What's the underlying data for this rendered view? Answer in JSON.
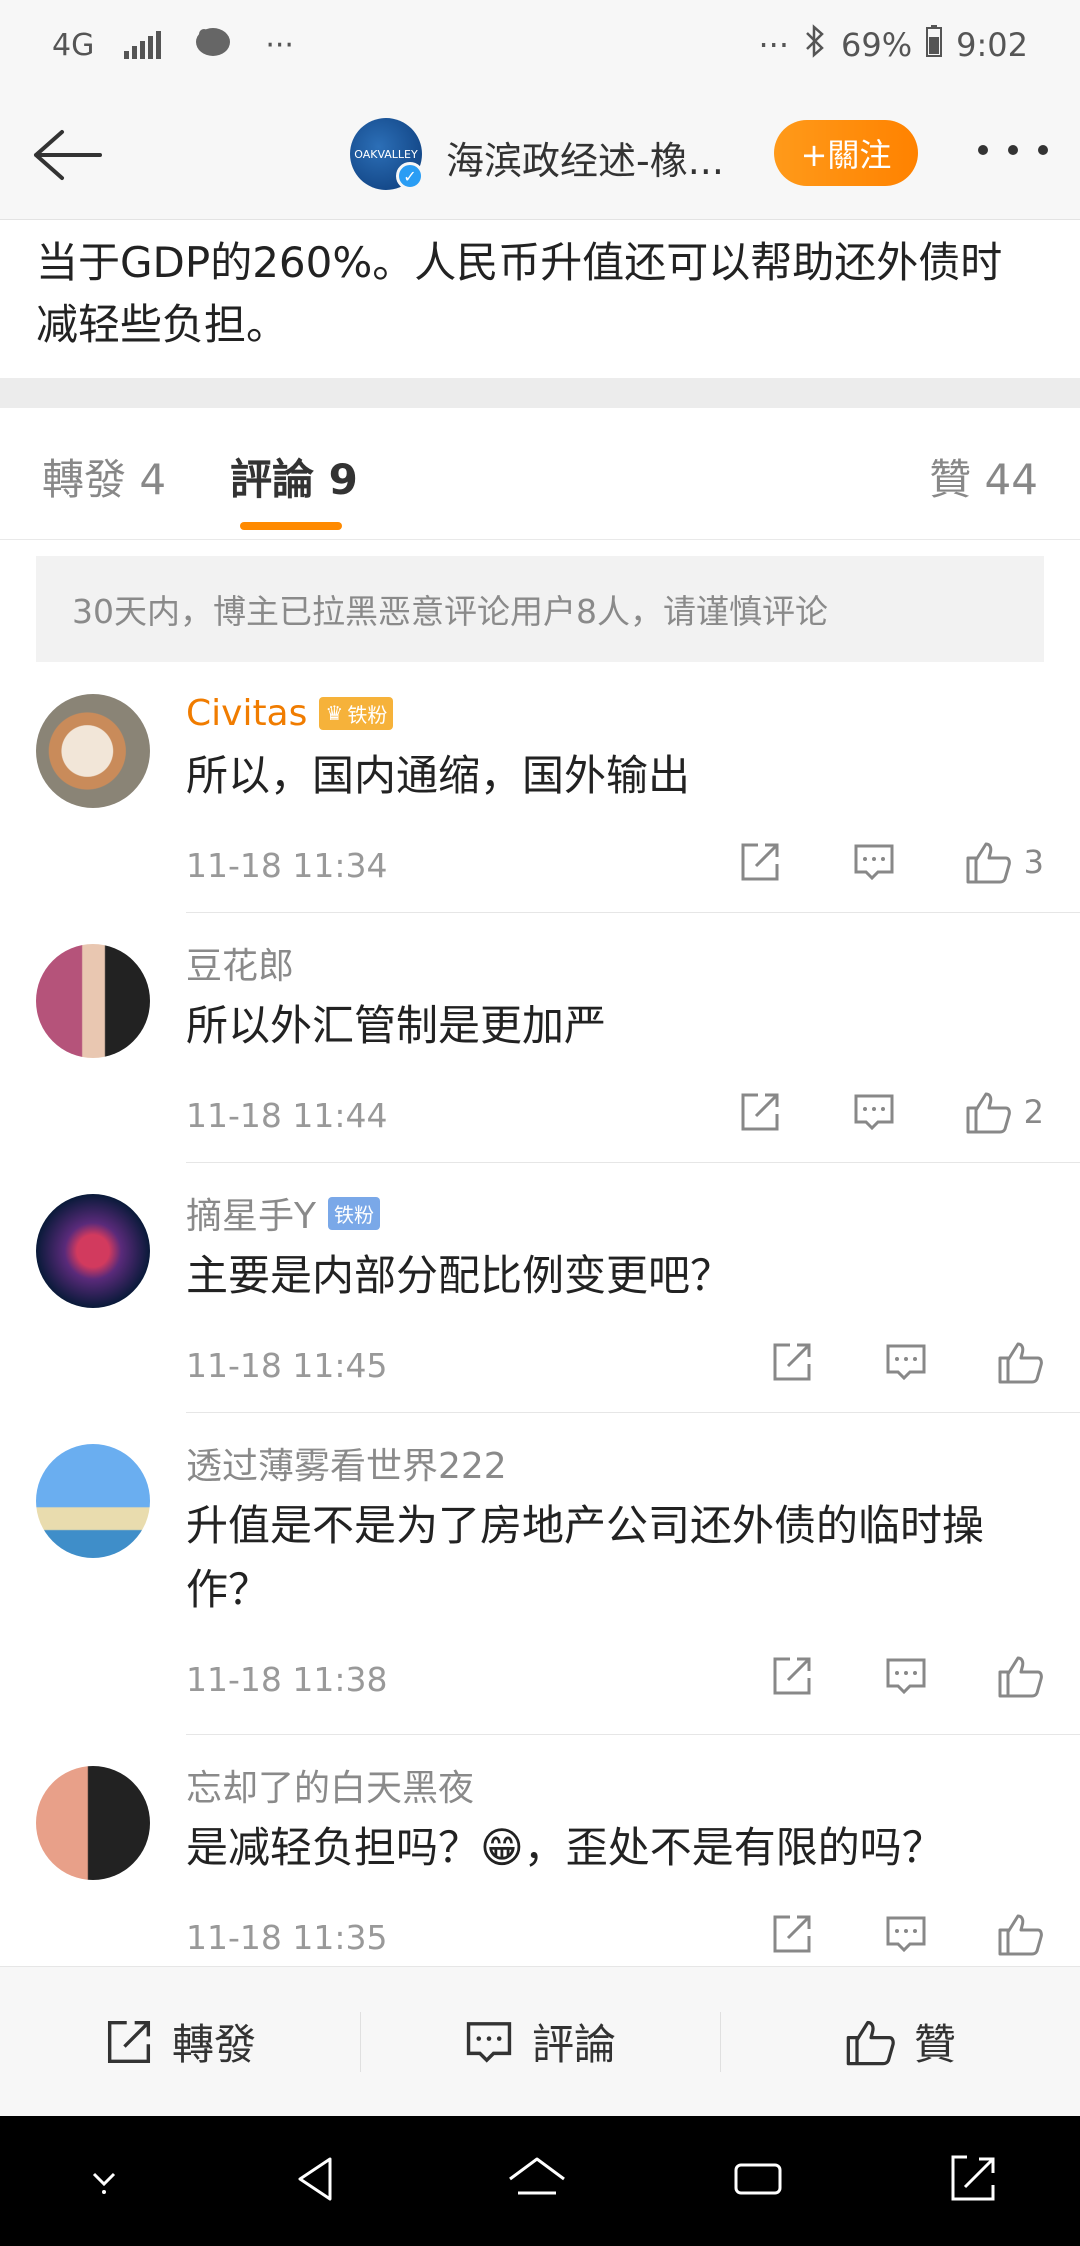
{
  "status_bar": {
    "network": "4G",
    "dots_left": "···",
    "dots_right": "···",
    "battery": "69%",
    "time": "9:02"
  },
  "header": {
    "title": "海滨政经述-橡...",
    "follow_label": "+關注",
    "avatar_text": "OAKVALLEY"
  },
  "post": {
    "text": "当于GDP的260%。人民币升值还可以帮助还外债时减轻些负担。"
  },
  "tabs": [
    {
      "label": "轉發 4"
    },
    {
      "label": "評論 9"
    },
    {
      "label": "贊 44"
    }
  ],
  "notice": "30天内，博主已拉黑恶意评论用户8人，请谨慎评论",
  "comments": [
    {
      "name": "Civitas",
      "badge": "铁粉",
      "text": "所以，国内通缩，国外输出",
      "time": "11-18 11:34",
      "likes": "3"
    },
    {
      "name": "豆花郎",
      "badge": "",
      "text": "所以外汇管制是更加严",
      "time": "11-18 11:44",
      "likes": "2"
    },
    {
      "name": "摘星手Y",
      "badge": "铁粉",
      "text": "主要是内部分配比例变更吧？",
      "time": "11-18 11:45",
      "likes": ""
    },
    {
      "name": "透过薄雾看世界222",
      "badge": "",
      "text": "升值是不是为了房地产公司还外债的临时操作？",
      "time": "11-18 11:38",
      "likes": ""
    },
    {
      "name": "忘却了的白天黑夜",
      "badge": "",
      "text": "是减轻负担吗？😁，歪处不是有限的吗？",
      "time": "11-18 11:35",
      "likes": ""
    }
  ],
  "bottom_bar": {
    "repost": "轉發",
    "comment": "評論",
    "like": "贊"
  },
  "colors": {
    "accent": "#ff8a00",
    "vip_name": "#f07c00",
    "fan_badge": "#7aa8e8"
  }
}
